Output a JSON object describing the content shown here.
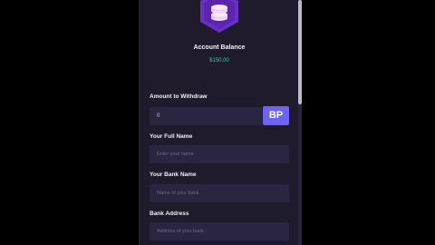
{
  "account": {
    "balance_label": "Account Balance",
    "balance_value": "$150.00"
  },
  "withdraw": {
    "amount_label": "Amount to Withdraw",
    "amount_value": "0",
    "currency_button": "BP"
  },
  "form": {
    "full_name": {
      "label": "Your Full Name",
      "placeholder": "Enter your name"
    },
    "bank_name": {
      "label": "Your Bank Name",
      "placeholder": "Name of your bank"
    },
    "bank_address": {
      "label": "Bank Address",
      "placeholder": "Address of your bank"
    }
  },
  "colors": {
    "background": "#1f1b2d",
    "field": "#2a2540",
    "accent": "#6d63f5",
    "badge": "#6a2fc4",
    "balance": "#39d39a"
  },
  "icons": {
    "badge": "coin-stack-icon"
  }
}
